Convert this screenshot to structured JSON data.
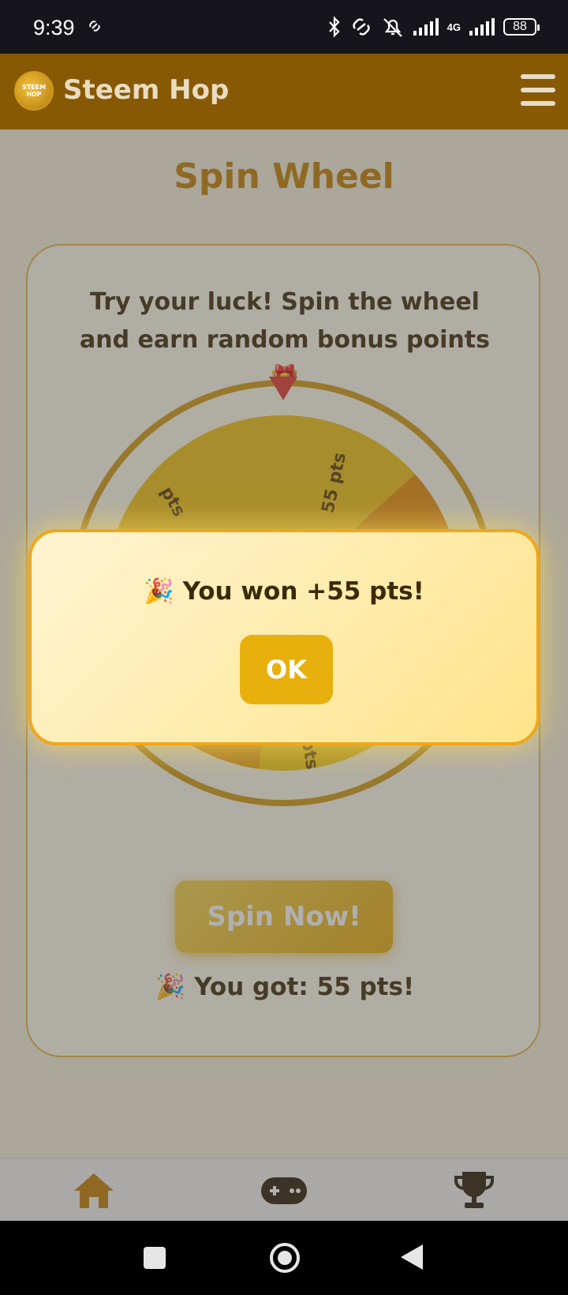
{
  "status_bar": {
    "time": "9:39",
    "battery": "88",
    "network": "4G"
  },
  "app_bar": {
    "brand": "Steem Hop",
    "logo_text": "STEEM HOP"
  },
  "page": {
    "title": "Spin Wheel",
    "subtitle": "Try your luck! Spin the wheel and earn random bonus points 🎁",
    "wheel_labels": [
      "55 pts",
      "pts",
      "1 pts"
    ],
    "spin_button": "Spin Now!",
    "result": "🎉 You got: 55 pts!"
  },
  "modal": {
    "message": "🎉 You won +55 pts!",
    "ok_label": "OK"
  },
  "bottom_nav": [
    {
      "icon": "home-icon"
    },
    {
      "icon": "gamepad-icon"
    },
    {
      "icon": "trophy-icon"
    }
  ],
  "colors": {
    "accent": "#875904",
    "title": "#c47f00",
    "button": "#e8b00d"
  }
}
